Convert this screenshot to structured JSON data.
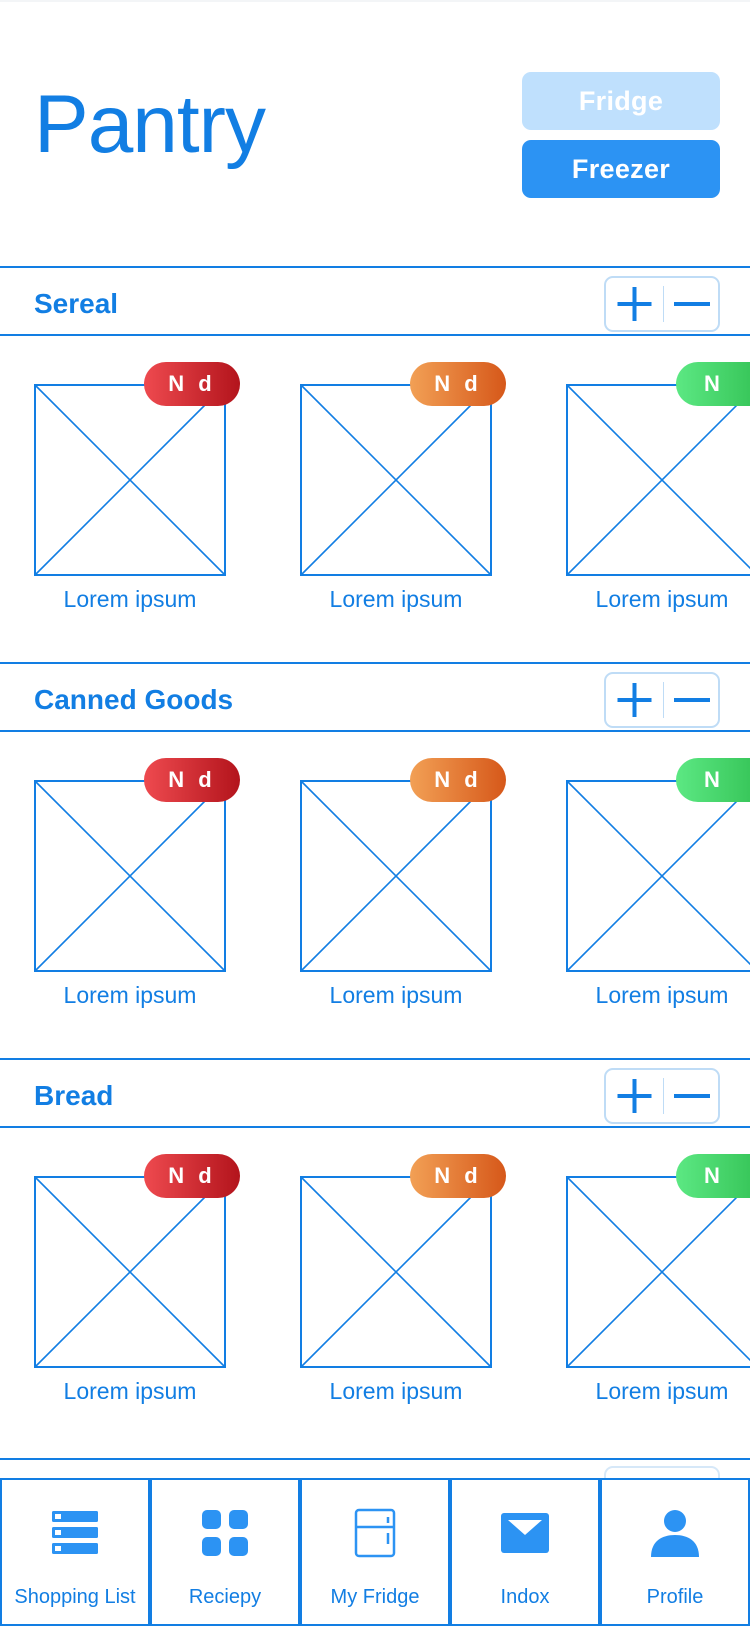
{
  "page": {
    "title": "Pantry"
  },
  "storage_toggle": {
    "fridge_label": "Fridge",
    "freezer_label": "Freezer",
    "selected": "Freezer"
  },
  "colors": {
    "accent": "#127ee3",
    "button_active": "#2c93f3",
    "button_inactive": "#bfe0fd"
  },
  "sections": [
    {
      "title": "Sereal",
      "stepper": {
        "plus": "plus-icon",
        "minus": "minus-icon"
      },
      "items": [
        {
          "badge": "N d",
          "badge_color": "red",
          "label": "Lorem ipsum"
        },
        {
          "badge": "N d",
          "badge_color": "orange",
          "label": "Lorem ipsum"
        },
        {
          "badge": "N",
          "badge_color": "green",
          "label": "Lorem ipsum"
        }
      ]
    },
    {
      "title": "Canned Goods",
      "stepper": {
        "plus": "plus-icon",
        "minus": "minus-icon"
      },
      "items": [
        {
          "badge": "N d",
          "badge_color": "red",
          "label": "Lorem ipsum"
        },
        {
          "badge": "N d",
          "badge_color": "orange",
          "label": "Lorem ipsum"
        },
        {
          "badge": "N",
          "badge_color": "green",
          "label": "Lorem ipsum"
        }
      ]
    },
    {
      "title": "Bread",
      "stepper": {
        "plus": "plus-icon",
        "minus": "minus-icon"
      },
      "items": [
        {
          "badge": "N d",
          "badge_color": "red",
          "label": "Lorem ipsum"
        },
        {
          "badge": "N d",
          "badge_color": "orange",
          "label": "Lorem ipsum"
        },
        {
          "badge": "N",
          "badge_color": "green",
          "label": "Lorem ipsum"
        }
      ]
    }
  ],
  "tab_bar": [
    {
      "label": "Shopping List",
      "icon": "list-icon"
    },
    {
      "label": "Reciepy",
      "icon": "grid-icon"
    },
    {
      "label": "My Fridge",
      "icon": "fridge-icon"
    },
    {
      "label": "Indox",
      "icon": "mail-icon"
    },
    {
      "label": "Profile",
      "icon": "person-icon"
    }
  ]
}
